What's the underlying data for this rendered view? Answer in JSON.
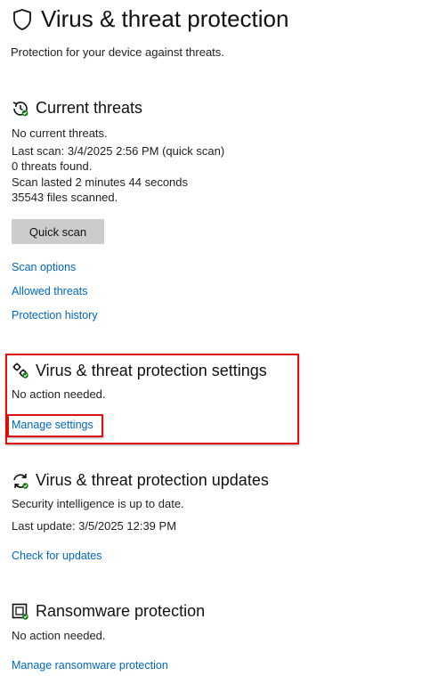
{
  "page": {
    "title": "Virus & threat protection",
    "subtitle": "Protection for your device against threats."
  },
  "current_threats": {
    "title": "Current threats",
    "icon": "history-shield-icon",
    "status": "No current threats.",
    "last_scan": "Last scan: 3/4/2025 2:56 PM (quick scan)",
    "threats_found": "0 threats found.",
    "scan_duration": "Scan lasted 2 minutes 44 seconds",
    "files_scanned": "35543 files scanned.",
    "quick_scan_label": "Quick scan",
    "links": [
      "Scan options",
      "Allowed threats",
      "Protection history"
    ]
  },
  "settings": {
    "title": "Virus & threat protection settings",
    "icon": "gears-icon",
    "status": "No action needed.",
    "link": "Manage settings"
  },
  "updates": {
    "title": "Virus & threat protection updates",
    "icon": "refresh-icon",
    "status": "Security intelligence is up to date.",
    "last_update": "Last update: 3/5/2025 12:39 PM",
    "link": "Check for updates"
  },
  "ransomware": {
    "title": "Ransomware protection",
    "icon": "ransomware-icon",
    "status": "No action needed.",
    "link": "Manage ransomware protection"
  },
  "colors": {
    "link": "#0067c0",
    "highlight": "#e01010",
    "ok_green": "#107c10",
    "button_bg": "#cccccc"
  }
}
